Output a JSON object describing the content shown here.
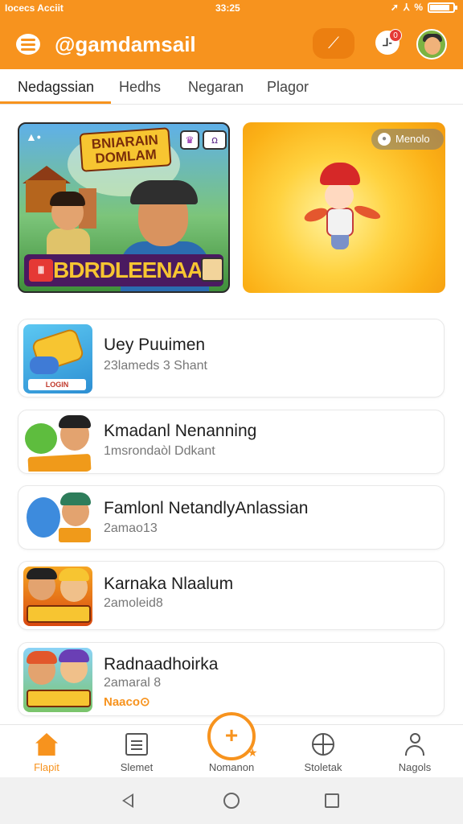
{
  "status_bar": {
    "carrier": "Iocecs Acciit",
    "time": "33:25",
    "icons": [
      "wifi-icon",
      "location-icon",
      "signal-icon",
      "battery-icon"
    ],
    "battery_level": 0.85
  },
  "app_bar": {
    "title": "@gamdamsail",
    "search_icon": "search-icon",
    "notification_count": "0",
    "notification_glyph": "⅃‑"
  },
  "tabs": [
    {
      "label": "Nedagssian",
      "active": true
    },
    {
      "label": "Hedhs",
      "active": false
    },
    {
      "label": "Negaran",
      "active": false
    },
    {
      "label": "Plagor",
      "active": false
    }
  ],
  "banners": {
    "first": {
      "title_art": "BNIARAIN DOMLAM",
      "name_art": "BDRDLEENAA",
      "badge": "Ⅲ",
      "corner": "▲•"
    },
    "second": {
      "pill_label": "Menolo"
    }
  },
  "games": [
    {
      "title": "Uey Puuimen",
      "subtitle": "23lameds 3 Shant",
      "thumb_label": "LOGIN"
    },
    {
      "title": "Kmadanl Nenanning",
      "subtitle": "1msrondaòl Ddkant"
    },
    {
      "title": "Famlonl NetandlyAnlassian",
      "subtitle": "2amao13"
    },
    {
      "title": "Karnaka Nlaalum",
      "subtitle": "2amoleid8"
    },
    {
      "title": "Radnaadhoirka",
      "subtitle": "2amaral 8",
      "tag": "Naaco⊙"
    }
  ],
  "bottom_nav": [
    {
      "label": "Flapit",
      "icon": "home-icon",
      "active": true
    },
    {
      "label": "Slemet",
      "icon": "list-icon",
      "active": false
    },
    {
      "label": "Nomanon",
      "icon": "add-icon",
      "active": false
    },
    {
      "label": "Stoletak",
      "icon": "globe-icon",
      "active": false
    },
    {
      "label": "Nagols",
      "icon": "profile-icon",
      "active": false
    }
  ],
  "colors": {
    "accent": "#f7931e",
    "text_primary": "#1e1e1e",
    "text_secondary": "#777777"
  }
}
